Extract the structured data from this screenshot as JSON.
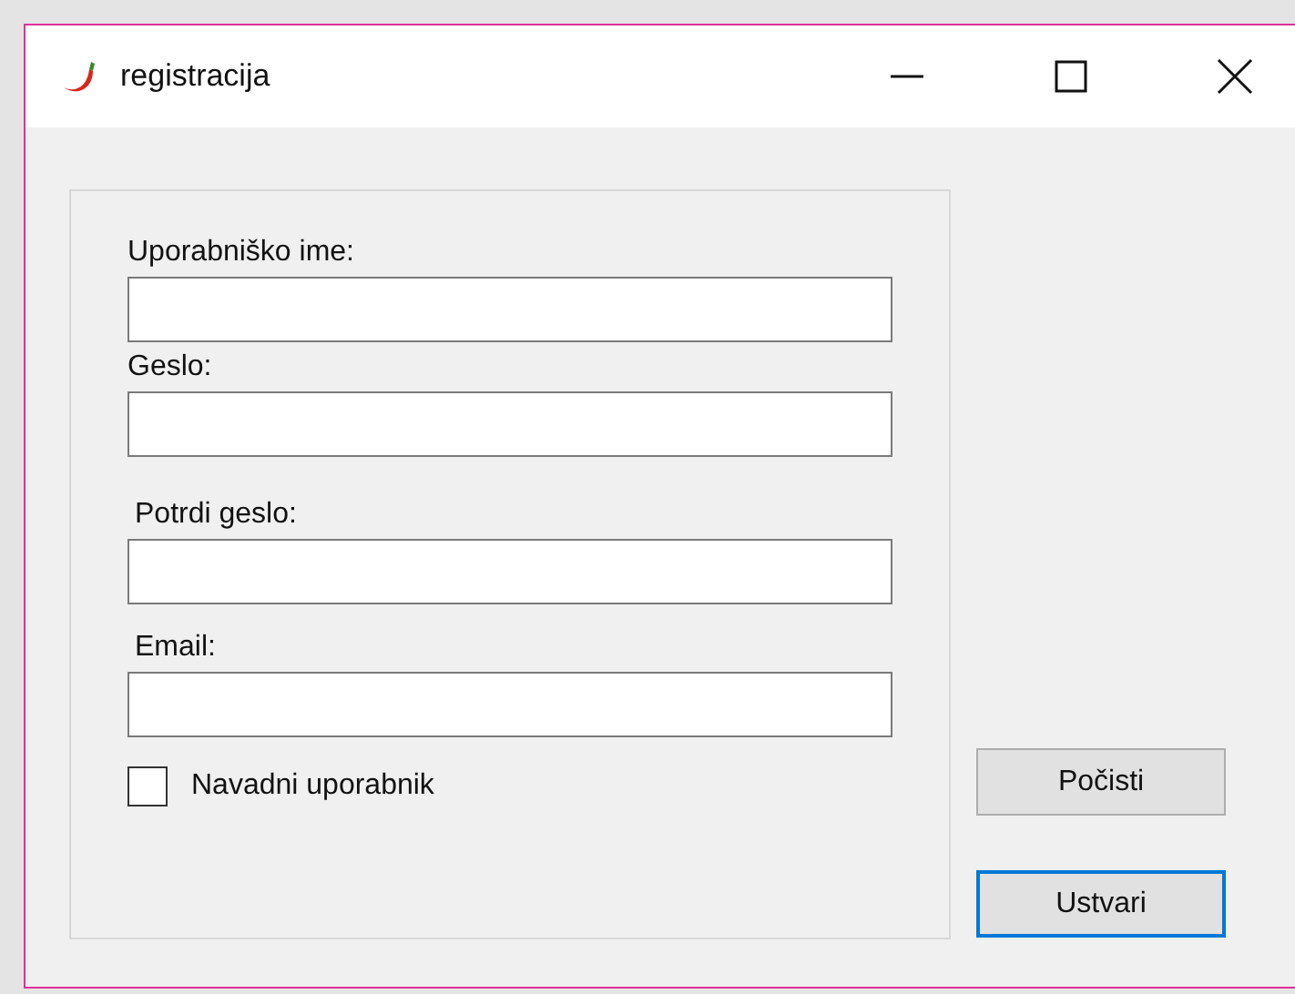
{
  "window": {
    "title": "registracija"
  },
  "fields": [
    {
      "label": "Uporabniško ime:"
    },
    {
      "label": "Geslo:"
    },
    {
      "label": "Potrdi geslo:"
    },
    {
      "label": "Email:"
    }
  ],
  "checkbox": {
    "label": "Navadni uporabnik",
    "checked": false
  },
  "buttons": [
    {
      "label": "Počisti",
      "focused": false
    },
    {
      "label": "Ustvari",
      "focused": true
    }
  ]
}
